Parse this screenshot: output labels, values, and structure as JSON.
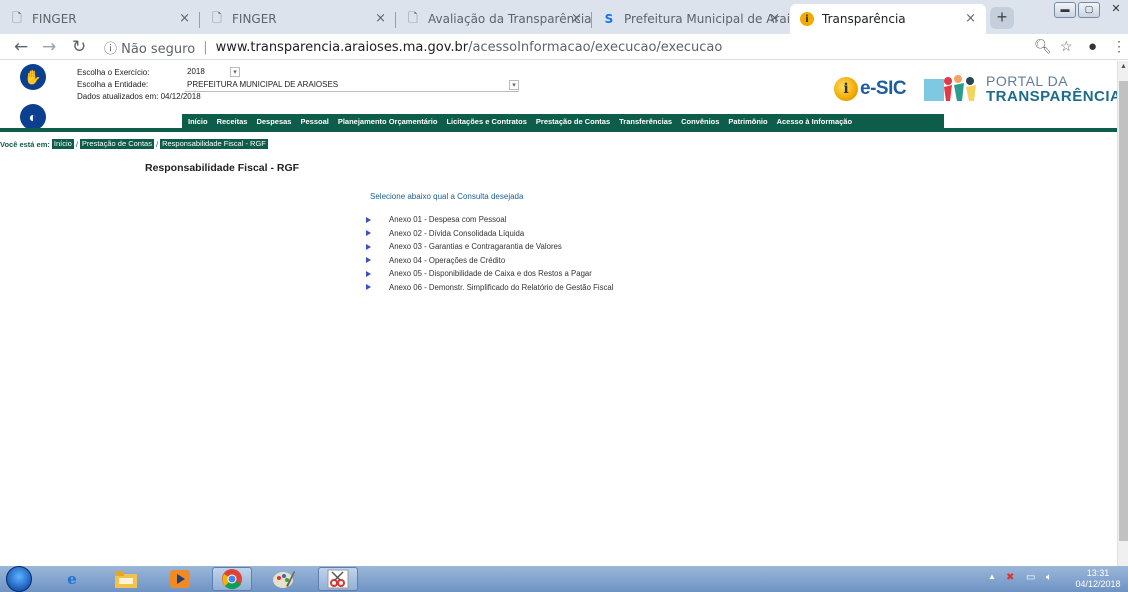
{
  "browser": {
    "tabs": [
      {
        "label": "FINGER",
        "icon": "document-icon"
      },
      {
        "label": "FINGER",
        "icon": "document-icon"
      },
      {
        "label": "Avaliação da Transparência dos",
        "icon": "document-icon"
      },
      {
        "label": "Prefeitura Municipal de Araiose",
        "icon": "s-logo-icon"
      },
      {
        "label": "Transparência",
        "icon": "info-icon"
      }
    ],
    "close_glyph": "×",
    "newtab_glyph": "+",
    "url": {
      "security": "ⓘ Não seguro",
      "host": "www.transparencia.araioses.ma.gov.br",
      "path": "/acessoInformacao/execucao/execucao"
    }
  },
  "header": {
    "exercicio_label": "Escolha o Exercício:",
    "exercicio_value": "2018",
    "entidade_label": "Escolha a Entidade:",
    "entidade_value": "PREFEITURA MUNICIPAL DE ARAIOSES",
    "dados_label": "Dados atualizados em: 04/12/2018",
    "esic_logo": "e-SIC",
    "portal_line1": "PORTAL DA",
    "portal_line2": "TRANSPARÊNCIA"
  },
  "nav": {
    "items": [
      "Início",
      "Receitas",
      "Despesas",
      "Pessoal",
      "Planejamento Orçamentário",
      "Licitações e Contratos",
      "Prestação de Contas",
      "Transferências",
      "Convênios",
      "Patrimônio",
      "Acesso à Informação"
    ]
  },
  "breadcrumb": {
    "lead": "Você está em:",
    "items": [
      "Início",
      "Prestação de Contas",
      "Responsabilidade Fiscal - RGF"
    ],
    "separator": "/"
  },
  "main": {
    "title": "Responsabilidade Fiscal - RGF",
    "prompt": "Selecione abaixo qual a Consulta desejada",
    "annexes": [
      "Anexo 01 - Despesa com Pessoal",
      "Anexo 02 - Dívida Consolidada Líquida",
      "Anexo 03 - Garantias e Contragarantia de Valores",
      "Anexo 04 - Operações de Crédito",
      "Anexo 05 - Disponibilidade de Caixa e dos Restos a Pagar",
      "Anexo 06 - Demonstr. Simplificado do Relatório de Gestão Fiscal"
    ]
  },
  "taskbar": {
    "time": "13:31",
    "date": "04/12/2018"
  },
  "colors": {
    "nav_green": "#0e5c4a",
    "link_blue": "#1b5e8f",
    "bullet_blue": "#3b4ec7"
  }
}
